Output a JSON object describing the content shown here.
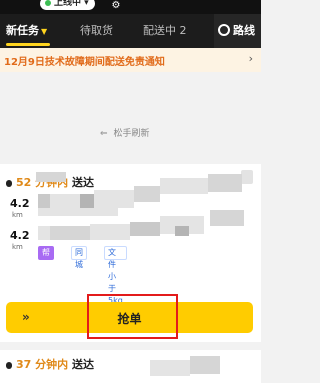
{
  "status_bar": {
    "online_label": "上线中",
    "online_chevron": "▾"
  },
  "tabs": [
    {
      "label": "新任务"
    },
    {
      "label": "待取货"
    },
    {
      "label": "配送中 2"
    }
  ],
  "route_button": {
    "label": "路线"
  },
  "notice": {
    "text": "12月9日技术故障期间配送免责通知",
    "chevron": "›"
  },
  "refresh": {
    "arrow": "⇐",
    "label": "松手刷新"
  },
  "order": {
    "time_prefix": "52 分钟内",
    "time_suffix": "送达",
    "distances": [
      {
        "value": "4.2",
        "unit": "km"
      },
      {
        "value": "4.2",
        "unit": "km"
      }
    ],
    "tags": [
      "帮送",
      "同城",
      "文件 小于 5kg"
    ],
    "grab_arrows": "»",
    "grab_label": "抢单"
  },
  "order2": {
    "time_prefix": "37 分钟内",
    "time_suffix": "送达"
  },
  "colors": {
    "accent": "#ffcc00",
    "highlight": "#e31b1b",
    "notice_text": "#e16b1a"
  }
}
